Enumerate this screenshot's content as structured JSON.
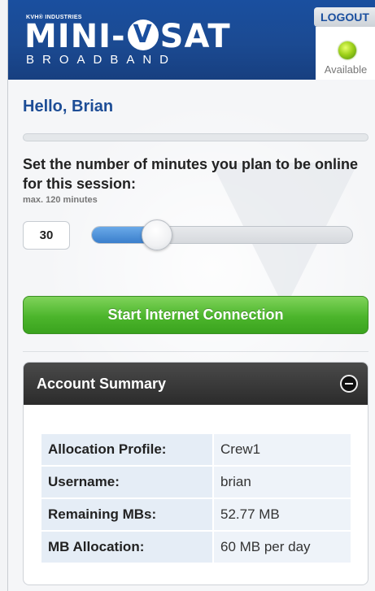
{
  "header": {
    "brand_top": "KVH® INDUSTRIES",
    "brand_main_left": "MINI-",
    "brand_main_v": "V",
    "brand_main_right": "SAT",
    "brand_sub": "BROADBAND",
    "logout_label": "LOGOUT",
    "status_label": "Available",
    "status_color": "#9fd11a"
  },
  "greeting": "Hello, Brian",
  "instruction": "Set the number of minutes you plan to be online for this session:",
  "max_note": "max. 120 minutes",
  "minutes_value": "30",
  "slider": {
    "value": 30,
    "max": 120
  },
  "start_button": "Start Internet Connection",
  "account": {
    "title": "Account Summary",
    "rows": [
      {
        "label": "Allocation Profile:",
        "value": "Crew1"
      },
      {
        "label": "Username:",
        "value": "brian"
      },
      {
        "label": "Remaining MBs:",
        "value": "52.77 MB"
      },
      {
        "label": "MB Allocation:",
        "value": "60 MB per day"
      }
    ]
  }
}
